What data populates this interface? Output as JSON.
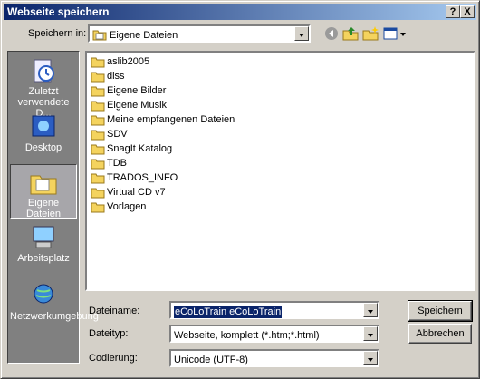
{
  "window": {
    "title": "Webseite speichern",
    "help_btn": "?",
    "close_btn": "X"
  },
  "lookin": {
    "label": "Speichern in:",
    "value": "Eigene Dateien"
  },
  "places": [
    {
      "label": "Zuletzt verwendete D...",
      "icon": "recent-documents-icon"
    },
    {
      "label": "Desktop",
      "icon": "desktop-icon"
    },
    {
      "label": "Eigene Dateien",
      "icon": "my-documents-icon",
      "selected": true
    },
    {
      "label": "Arbeitsplatz",
      "icon": "my-computer-icon"
    },
    {
      "label": "Netzwerkumgebung",
      "icon": "network-icon"
    }
  ],
  "files": [
    "aslib2005",
    "diss",
    "Eigene Bilder",
    "Eigene Musik",
    "Meine empfangenen Dateien",
    "SDV",
    "SnagIt Katalog",
    "TDB",
    "TRADOS_INFO",
    "Virtual CD v7",
    "Vorlagen"
  ],
  "filename": {
    "label": "Dateiname:",
    "value": "eCoLoTrain eCoLoTrain"
  },
  "filetype": {
    "label": "Dateityp:",
    "value": "Webseite, komplett (*.htm;*.html)"
  },
  "encoding": {
    "label": "Codierung:",
    "value": "Unicode (UTF-8)"
  },
  "buttons": {
    "save": "Speichern",
    "cancel": "Abbrechen"
  },
  "colors": {
    "title_start": "#0a246a",
    "title_end": "#a6caf0",
    "folder": "#f4d35e",
    "selection": "#0a246a"
  }
}
